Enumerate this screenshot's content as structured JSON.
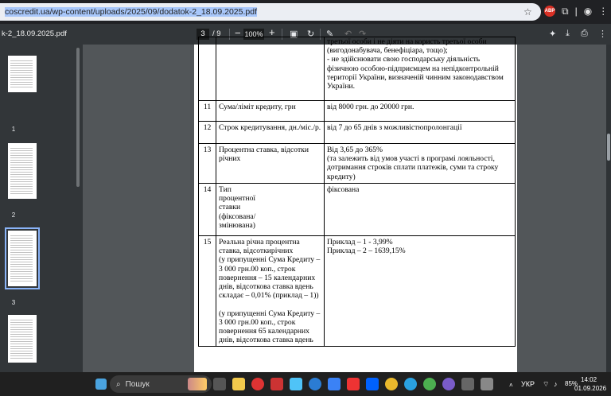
{
  "browser": {
    "url_selected": "coscredit.ua/wp-content/uploads/2025/09/dodatok-2_18.09.2025.pdf",
    "adblock_label": "ABP"
  },
  "pdf_toolbar": {
    "title": "k-2_18.09.2025.pdf",
    "page_current": "3",
    "page_total": "/  9",
    "zoom": "100%"
  },
  "sidebar": {
    "thumbnails": [
      {
        "number": "1"
      },
      {
        "number": "2"
      },
      {
        "number": "3",
        "selected": true
      }
    ]
  },
  "document": {
    "rows": [
      {
        "num": "",
        "label": "",
        "value": "третьої особи і не діяти на користь третьої особи (вигодонабувача, бенефіціара, тощо);\n- не здійснювати свою господарську діяльність фізичною особою-підприємцем на непідконтрольній території України, визначеній чинним законодавством України."
      },
      {
        "num": "11",
        "label": "Сума/ліміт кредиту, грн",
        "value": "від 8000 грн. до 20000 грн."
      },
      {
        "num": "12",
        "label": "Строк кредитування, дн./міс./р.",
        "value": "від 7 до 65 днів з можливістюпролонгації"
      },
      {
        "num": "13",
        "label": "Процентна ставка, відсотки річних",
        "value": "Від 3,65 до 365%\n(та залежить від умов участі в програмі лояльності, дотримання строків сплати платежів, суми та строку кредиту)"
      },
      {
        "num": "14",
        "label": "Тип\nпроцентної\nставки\n(фіксована/\nзмінювана)",
        "value": "фіксована"
      },
      {
        "num": "15",
        "label": "Реальна річна процентна ставка, відсоткирічних\n(у припущенні Сума Кредиту – 3 000 грн.00 коп., строк повернення – 15 календарних днів, відсоткова ставка вдень складає – 0,01% (приклад – 1))\n\n(у припущенні Сума Кредиту –3 000 грн.00 коп., строк повернення 65 календарних днів, відсоткова ставка вдень",
        "value": "Приклад – 1 - 3,99%\nПриклад – 2 – 1639,15%"
      }
    ]
  },
  "taskbar": {
    "search_label": "Пошук",
    "lang": "УКР",
    "battery": "85%",
    "time": "14:02",
    "date": "01.09.2026"
  }
}
